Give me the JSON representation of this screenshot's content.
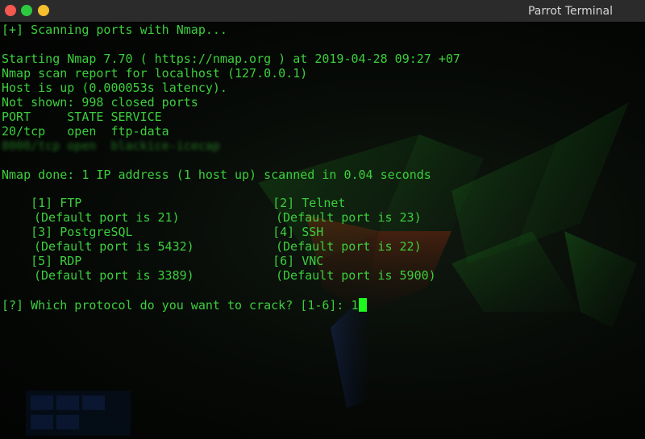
{
  "window": {
    "title": "Parrot Terminal"
  },
  "terminal": {
    "lines": [
      "[+] Scanning ports with Nmap...",
      "",
      "Starting Nmap 7.70 ( https://nmap.org ) at 2019-04-28 09:27 +07",
      "Nmap scan report for localhost (127.0.0.1)",
      "Host is up (0.000053s latency).",
      "Not shown: 998 closed ports",
      "PORT     STATE SERVICE",
      "20/tcp   open  ftp-data",
      "8000/tcp open  blackice-icecap",
      "",
      "Nmap done: 1 IP address (1 host up) scanned in 0.04 seconds"
    ],
    "menu": [
      {
        "label": "    [1] FTP",
        "hint": "(Default port is 21)"
      },
      {
        "label": "    [2] Telnet",
        "hint": "(Default port is 23)"
      },
      {
        "label": "    [3] PostgreSQL",
        "hint": "(Default port is 5432)"
      },
      {
        "label": "    [4] SSH",
        "hint": "(Default port is 22)"
      },
      {
        "label": "    [5] RDP",
        "hint": "(Default port is 3389)"
      },
      {
        "label": "    [6] VNC",
        "hint": "(Default port is 5900)"
      }
    ],
    "prompt": "[?] Which protocol do you want to crack? [1-6]: ",
    "input_value": "1"
  },
  "colors": {
    "terminal_text": "#3cce3c",
    "cursor": "#1dfb1d",
    "titlebar": "#2b2b2b",
    "close_button": "#f4584f",
    "maximize_button": "#2ec840",
    "minimize_button": "#f5be2e"
  }
}
